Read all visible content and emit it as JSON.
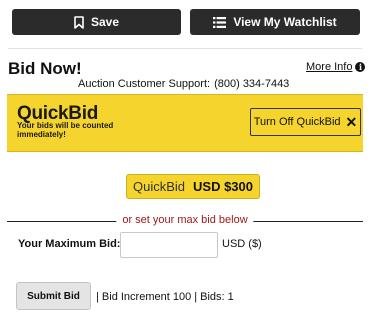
{
  "toolbar": {
    "save_label": "Save",
    "watchlist_label": "View My Watchlist",
    "icons": {
      "save": "bookmark-icon",
      "watchlist": "list-icon"
    }
  },
  "header": {
    "title": "Bid Now!",
    "more_info_label": "More Info",
    "more_info_icon": "info-icon",
    "support_label": "Auction Customer Support:",
    "support_phone": "(800) 334-7443"
  },
  "quickbid": {
    "logo": "QuickBid",
    "subtitle": "Your bids will be counted immediately!",
    "turn_off_label": "Turn Off QuickBid",
    "close_icon": "close-icon",
    "bar_color": "#f6d42e",
    "amount_prefix": "QuickBid",
    "amount_value": "USD $300"
  },
  "max_bid": {
    "divider_text": "or set your max bid below",
    "label": "Your Maximum Bid:",
    "input_value": "",
    "input_placeholder": "",
    "currency": "USD ($)"
  },
  "submit": {
    "label": "Submit Bid",
    "meta": "| Bid Increment 100 | Bids: 1"
  }
}
